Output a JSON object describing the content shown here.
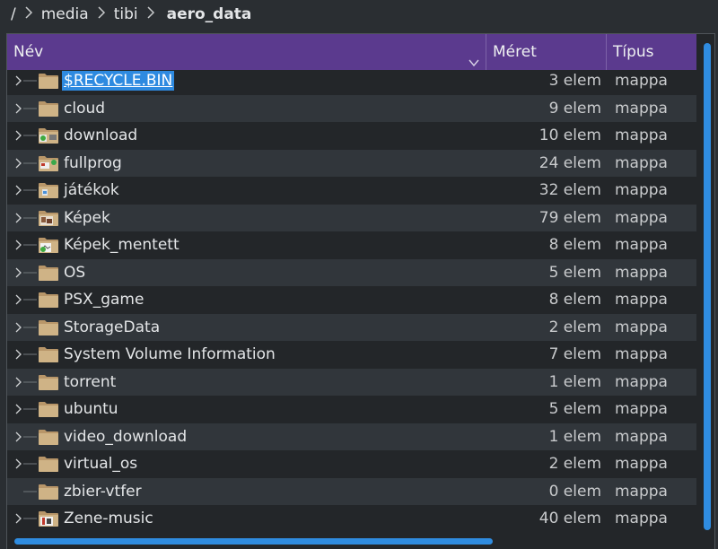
{
  "breadcrumb": {
    "root": "/",
    "items": [
      "media",
      "tibi"
    ],
    "current": "aero_data"
  },
  "header": {
    "name": "Név",
    "size": "Méret",
    "type": "Típus"
  },
  "rows": [
    {
      "name": "$RECYCLE.BIN",
      "size": "3 elem",
      "type": "mappa",
      "icon": "folder-icon",
      "expandable": true,
      "selected": true
    },
    {
      "name": "cloud",
      "size": "9 elem",
      "type": "mappa",
      "icon": "folder-icon",
      "expandable": true
    },
    {
      "name": "download",
      "size": "10 elem",
      "type": "mappa",
      "icon": "folder-download-icon",
      "expandable": true
    },
    {
      "name": "fullprog",
      "size": "24 elem",
      "type": "mappa",
      "icon": "folder-program-icon",
      "expandable": true
    },
    {
      "name": "játékok",
      "size": "32 elem",
      "type": "mappa",
      "icon": "folder-games-icon",
      "expandable": true
    },
    {
      "name": "Képek",
      "size": "79 elem",
      "type": "mappa",
      "icon": "folder-pictures-icon",
      "expandable": true
    },
    {
      "name": "Képek_mentett",
      "size": "8 elem",
      "type": "mappa",
      "icon": "folder-pictures-saved-icon",
      "expandable": true
    },
    {
      "name": "OS",
      "size": "5 elem",
      "type": "mappa",
      "icon": "folder-icon",
      "expandable": true
    },
    {
      "name": "PSX_game",
      "size": "8 elem",
      "type": "mappa",
      "icon": "folder-icon",
      "expandable": true
    },
    {
      "name": "StorageData",
      "size": "2 elem",
      "type": "mappa",
      "icon": "folder-icon",
      "expandable": true
    },
    {
      "name": "System Volume Information",
      "size": "7 elem",
      "type": "mappa",
      "icon": "folder-icon",
      "expandable": true
    },
    {
      "name": "torrent",
      "size": "1 elem",
      "type": "mappa",
      "icon": "folder-icon",
      "expandable": true
    },
    {
      "name": "ubuntu",
      "size": "5 elem",
      "type": "mappa",
      "icon": "folder-icon",
      "expandable": true
    },
    {
      "name": "video_download",
      "size": "1 elem",
      "type": "mappa",
      "icon": "folder-icon",
      "expandable": true
    },
    {
      "name": "virtual_os",
      "size": "2 elem",
      "type": "mappa",
      "icon": "folder-icon",
      "expandable": true
    },
    {
      "name": "zbier-vtfer",
      "size": "0 elem",
      "type": "mappa",
      "icon": "folder-icon",
      "expandable": false
    },
    {
      "name": "Zene-music",
      "size": "40 elem",
      "type": "mappa",
      "icon": "folder-music-icon",
      "expandable": true
    }
  ],
  "colors": {
    "header_bg": "#5b3a8e",
    "selection": "#2e8ae0",
    "scrollbar": "#2f8ce0",
    "folder": "#c8aa7e"
  }
}
